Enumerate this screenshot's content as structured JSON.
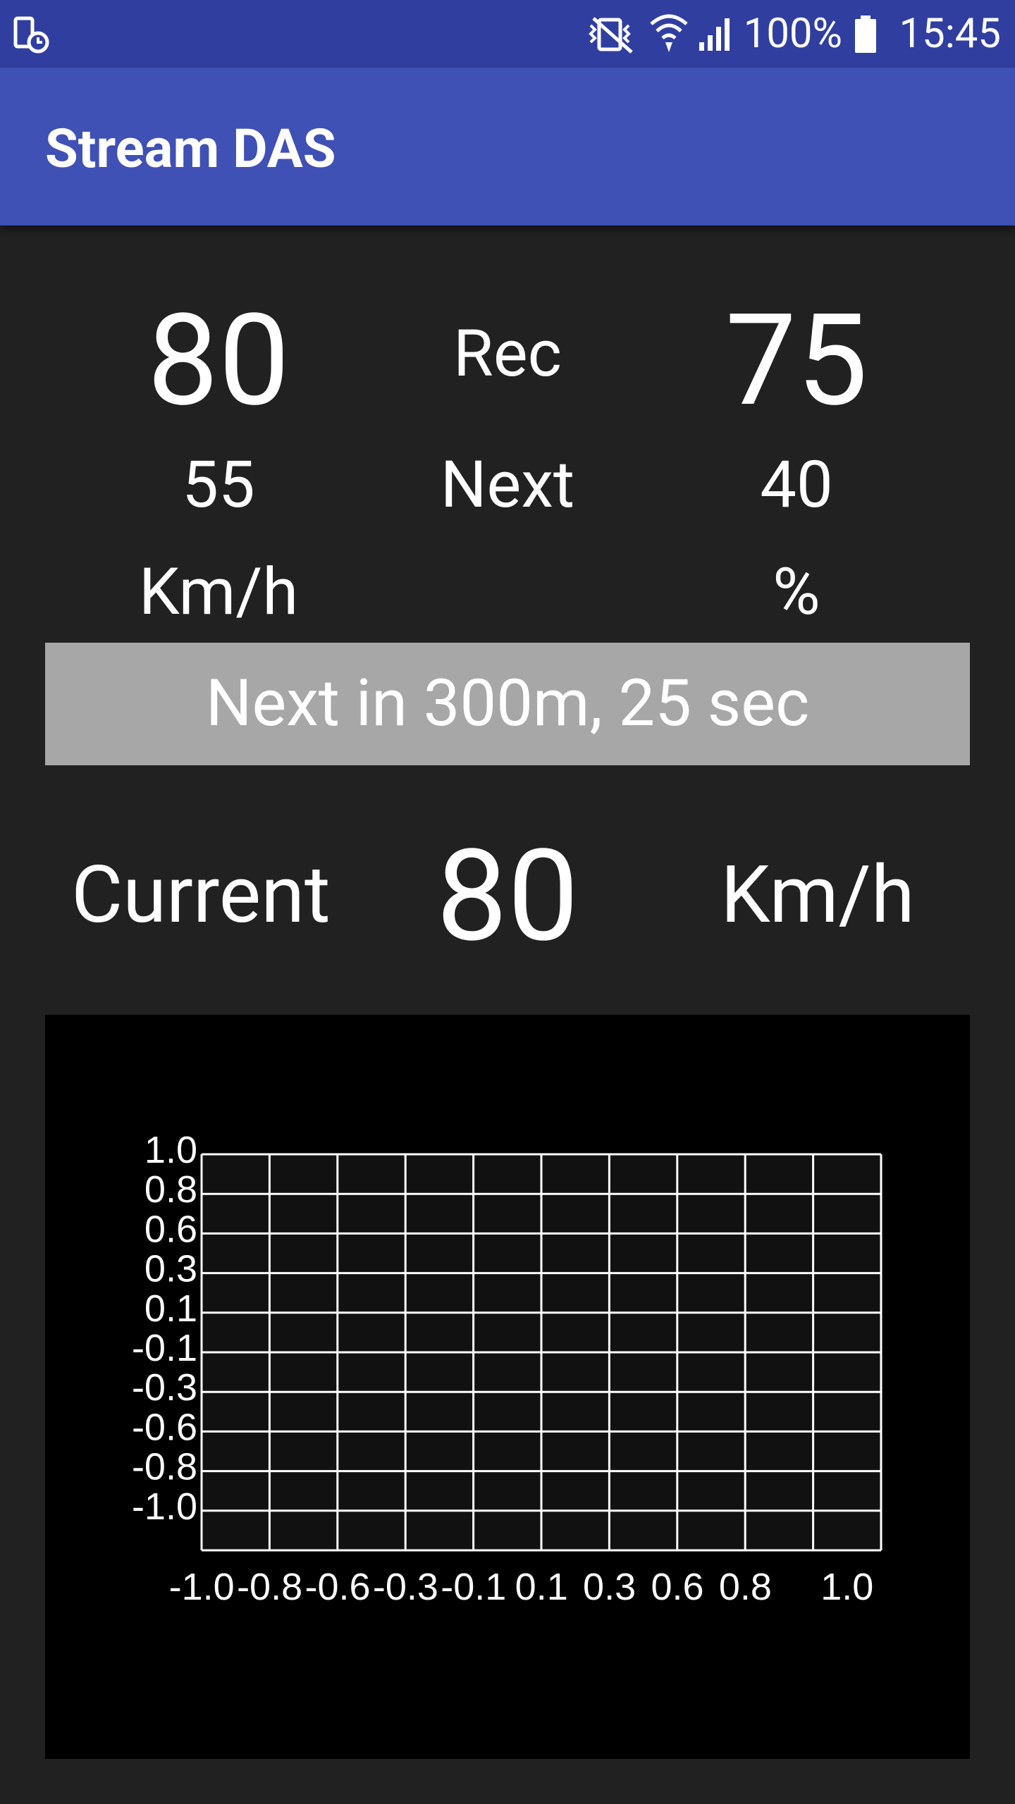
{
  "status_bar": {
    "battery": "100%",
    "time": "15:45",
    "icons": [
      "device-clock-icon",
      "vibrate-mute-icon",
      "wifi-icon",
      "signal-icon",
      "battery-icon"
    ]
  },
  "app_bar": {
    "title": "Stream DAS"
  },
  "speed_panel": {
    "left": {
      "current": "80",
      "next": "55",
      "unit": "Km/h"
    },
    "center": {
      "rec_label": "Rec",
      "next_label": "Next"
    },
    "right": {
      "current": "75",
      "next": "40",
      "unit": "%"
    }
  },
  "next_banner": "Next in 300m, 25 sec",
  "current": {
    "label": "Current",
    "value": "80",
    "unit": "Km/h"
  },
  "chart_data": {
    "type": "scatter",
    "x_ticks": [
      "-1.0",
      "-0.8",
      "-0.6",
      "-0.3",
      "-0.1",
      "0.1",
      "0.3",
      "0.6",
      "0.8",
      "1.0"
    ],
    "y_ticks": [
      "1.0",
      "0.8",
      "0.6",
      "0.3",
      "0.1",
      "-0.1",
      "-0.3",
      "-0.6",
      "-0.8",
      "-1.0"
    ],
    "xlim": [
      -1.0,
      1.0
    ],
    "ylim": [
      -1.0,
      1.0
    ],
    "grid": true,
    "series": [],
    "colors": {
      "plot_bg": "#111111",
      "panel_bg": "#000000",
      "grid": "#ffffff"
    }
  },
  "colors": {
    "status_bar": "#303f9f",
    "app_bar": "#3f51b5",
    "background": "#212121",
    "banner": "#a7a7a7"
  }
}
